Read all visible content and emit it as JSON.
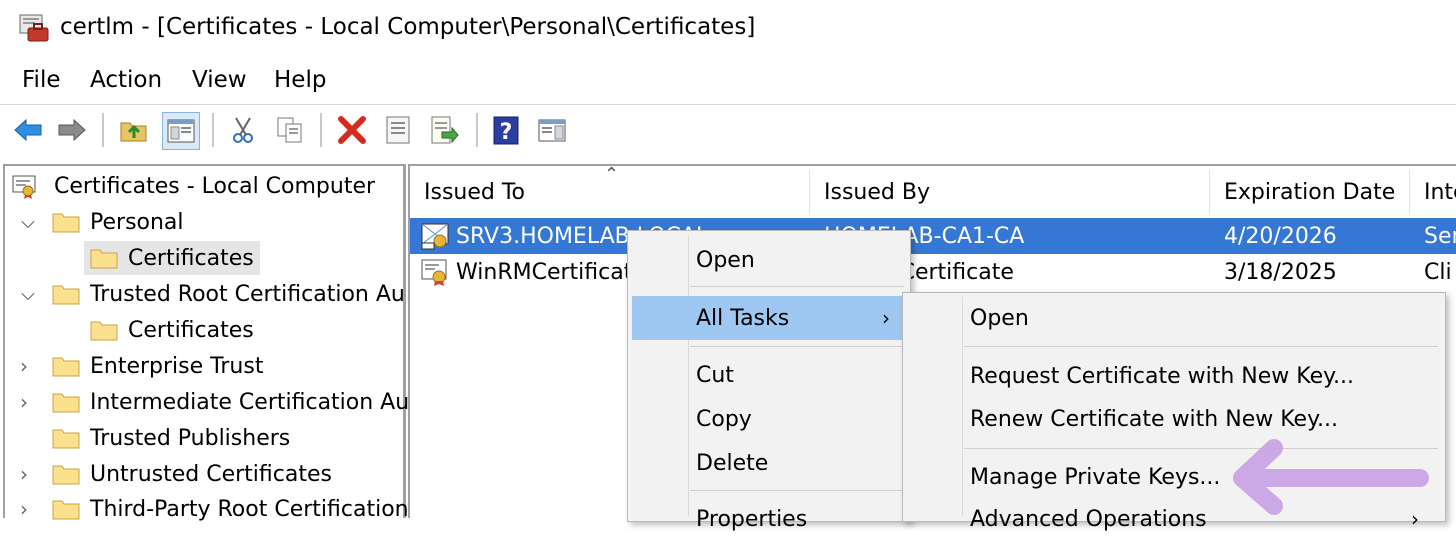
{
  "window": {
    "title": "certlm - [Certificates - Local Computer\\Personal\\Certificates]"
  },
  "menu": [
    "File",
    "Action",
    "View",
    "Help"
  ],
  "toolbar": [
    "back-arrow-icon",
    "forward-arrow-icon",
    "up-folder-icon",
    "show-hide-tree-icon",
    "cut-icon",
    "copy-icon",
    "delete-icon",
    "properties-icon",
    "export-list-icon",
    "help-icon",
    "show-action-pane-icon"
  ],
  "tree": {
    "root": "Certificates - Local Computer",
    "items": [
      {
        "label": "Personal",
        "expanded": true
      },
      {
        "label": "Certificates",
        "selected": true
      },
      {
        "label": "Trusted Root Certification Au",
        "expanded": true
      },
      {
        "label": "Certificates"
      },
      {
        "label": "Enterprise Trust"
      },
      {
        "label": "Intermediate Certification Au"
      },
      {
        "label": "Trusted Publishers"
      },
      {
        "label": "Untrusted Certificates"
      },
      {
        "label": "Third-Party Root Certification"
      }
    ]
  },
  "list": {
    "columns": [
      "Issued To",
      "Issued By",
      "Expiration Date",
      "Inte"
    ],
    "rows": [
      {
        "issued_to": "SRV3.HOMELAB.LOCAL",
        "issued_by": "HOMELAB-CA1-CA",
        "expiration": "4/20/2026",
        "intended": "Ser",
        "selected": true
      },
      {
        "issued_to": "WinRMCertificate",
        "issued_by": "WinRMCertificate",
        "expiration": "3/18/2025",
        "intended": "Cli"
      }
    ]
  },
  "context_menu": {
    "items": [
      "Open",
      "All Tasks",
      "Cut",
      "Copy",
      "Delete",
      "Properties"
    ],
    "highlighted": "All Tasks"
  },
  "submenu": {
    "items": [
      "Open",
      "Request Certificate with New Key...",
      "Renew Certificate with New Key...",
      "Manage Private Keys...",
      "Advanced Operations"
    ]
  },
  "colors": {
    "selection": "#3577d5",
    "menu_highlight": "#9ec8f2",
    "annotation_arrow": "#c9a0e6"
  }
}
